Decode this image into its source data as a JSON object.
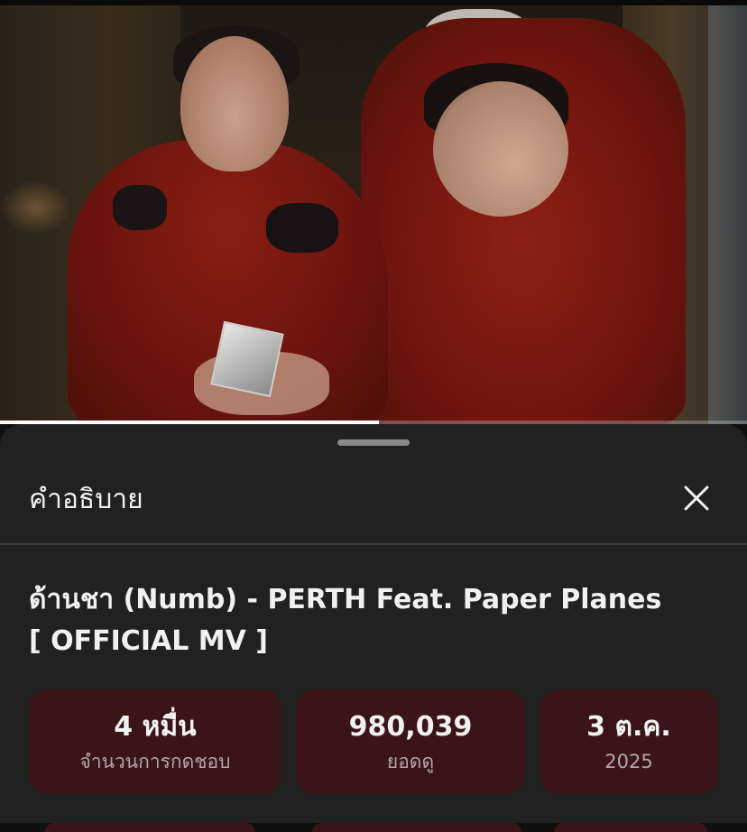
{
  "video": {
    "progress_fraction": 0.507
  },
  "description_sheet": {
    "header_title": "คำอธิบาย",
    "close_icon": "close-icon",
    "video_title_line1": "ด้านชา (Numb) - PERTH Feat. Paper Planes",
    "video_title_line2": "[ OFFICIAL MV ]",
    "stats": [
      {
        "value": "4 หมื่น",
        "label": "จำนวนการกดชอบ"
      },
      {
        "value": "980,039",
        "label": "ยอดดู"
      },
      {
        "value": "3 ต.ค.",
        "label": "2025"
      }
    ]
  },
  "colors": {
    "sheet_background": "#212121",
    "stat_chip_background": "#3a1416",
    "progress_fill": "#ffffff"
  }
}
